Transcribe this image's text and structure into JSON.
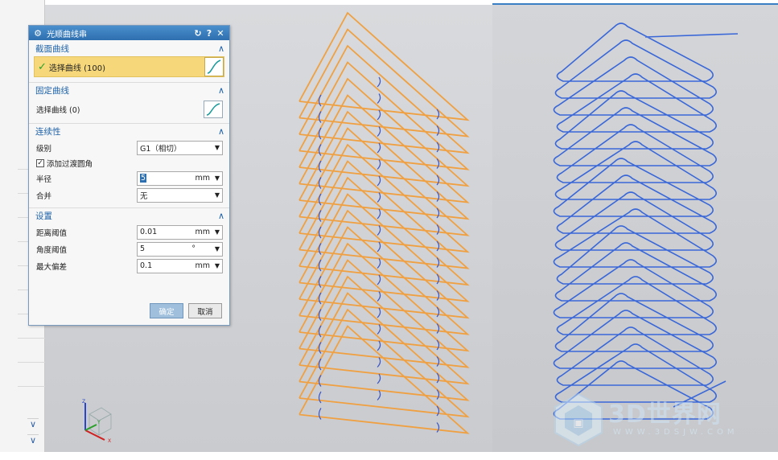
{
  "dialog": {
    "title": "光顺曲线串",
    "title_buttons": [
      "↻",
      "?",
      "✕"
    ],
    "sections": {
      "section_curves": {
        "header": "截面曲线",
        "select_label": "选择曲线 (100)"
      },
      "fixed_curves": {
        "header": "固定曲线",
        "select_label": "选择曲线 (0)"
      },
      "continuity": {
        "header": "连续性",
        "level_label": "级别",
        "level_value": "G1（相切）",
        "fillet_checkbox_label": "添加过渡圆角",
        "fillet_checked": true,
        "radius_label": "半径",
        "radius_value": "5",
        "radius_unit": "mm",
        "merge_label": "合并",
        "merge_value": "无"
      },
      "settings": {
        "header": "设置",
        "distance_label": "距离阈值",
        "distance_value": "0.01",
        "distance_unit": "mm",
        "angle_label": "角度阈值",
        "angle_value": "5",
        "angle_unit": "°",
        "deviation_label": "最大偏差",
        "deviation_value": "0.1",
        "deviation_unit": "mm"
      }
    },
    "ok_label": "确定",
    "cancel_label": "取消"
  },
  "colors": {
    "accent": "#1e62a8",
    "title_bar": "#2e6faf",
    "orange_curves": "#f0a040",
    "blue_curves": "#3a67d8",
    "active_selection": "#f6d77a"
  },
  "viewport": {
    "triad_labels": {
      "x": "X",
      "y": "Y",
      "z": "Z"
    }
  },
  "watermark": {
    "brand": "3D世界网",
    "url": "WWW.3DSJW.COM"
  },
  "icons": [
    "gear-icon",
    "reset-icon",
    "help-icon",
    "close-icon",
    "chevron-up-icon",
    "curve-select-icon",
    "chevron-down-icon",
    "check-icon"
  ]
}
